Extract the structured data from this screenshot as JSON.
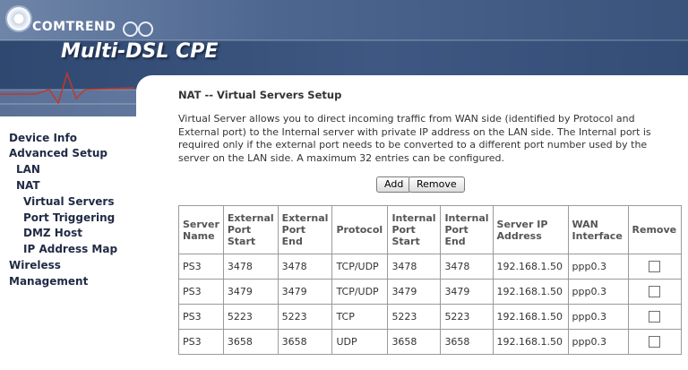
{
  "header": {
    "brand": "COMTREND",
    "product": "Multi-DSL CPE"
  },
  "sidebar": {
    "items": [
      {
        "label": "Device Info"
      },
      {
        "label": "Advanced Setup"
      },
      {
        "label": "LAN"
      },
      {
        "label": "NAT"
      },
      {
        "label": "Virtual Servers"
      },
      {
        "label": "Port Triggering"
      },
      {
        "label": "DMZ Host"
      },
      {
        "label": "IP Address Map"
      },
      {
        "label": "Wireless"
      },
      {
        "label": "Management"
      }
    ]
  },
  "main": {
    "title": "NAT -- Virtual Servers Setup",
    "description": "Virtual Server allows you to direct incoming traffic from WAN side (identified by Protocol and External port) to the Internal server with private IP address on the LAN side. The Internal port is required only if the external port needs to be converted to a different port number used by the server on the LAN side. A maximum 32 entries can be configured.",
    "add_label": "Add",
    "remove_label": "Remove"
  },
  "table": {
    "headers": [
      "Server Name",
      "External Port Start",
      "External Port End",
      "Protocol",
      "Internal Port Start",
      "Internal Port End",
      "Server IP Address",
      "WAN Interface",
      "Remove"
    ],
    "rows": [
      [
        "PS3",
        "3478",
        "3478",
        "TCP/UDP",
        "3478",
        "3478",
        "192.168.1.50",
        "ppp0.3"
      ],
      [
        "PS3",
        "3479",
        "3479",
        "TCP/UDP",
        "3479",
        "3479",
        "192.168.1.50",
        "ppp0.3"
      ],
      [
        "PS3",
        "5223",
        "5223",
        "TCP",
        "5223",
        "5223",
        "192.168.1.50",
        "ppp0.3"
      ],
      [
        "PS3",
        "3658",
        "3658",
        "UDP",
        "3658",
        "3658",
        "192.168.1.50",
        "ppp0.3"
      ]
    ]
  },
  "colors": {
    "header_bg": "#3d5578",
    "nav_text": "#1f2a44"
  }
}
